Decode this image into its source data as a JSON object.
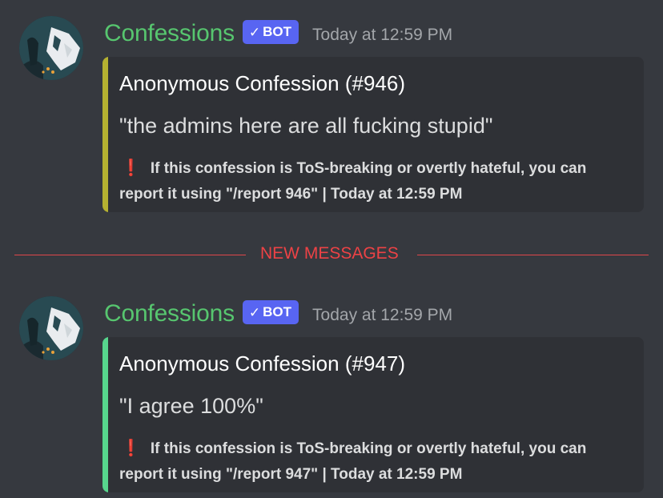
{
  "messages": [
    {
      "author": "Confessions",
      "bot_tag": "BOT",
      "timestamp": "Today at 12:59 PM",
      "embed": {
        "title": "Anonymous Confession (#946)",
        "description": "\"the admins here are all fucking stupid\"",
        "footer_icon": "❗",
        "footer_text": "If this confession is ToS-breaking or overtly hateful, you can report it using \"/report 946\" | Today at 12:59 PM",
        "color": "#b5b131"
      }
    },
    {
      "author": "Confessions",
      "bot_tag": "BOT",
      "timestamp": "Today at 12:59 PM",
      "embed": {
        "title": "Anonymous Confession (#947)",
        "description": "\"I agree 100%\"",
        "footer_icon": "❗",
        "footer_text": "If this confession is ToS-breaking or overtly hateful, you can report it using \"/report 947\" | Today at 12:59 PM",
        "color": "#57d68d"
      }
    }
  ],
  "divider": {
    "label": "NEW MESSAGES"
  },
  "icons": {
    "bot_check": "check-icon",
    "footer": "exclamation-icon"
  },
  "colors": {
    "background": "#36393f",
    "embed_background": "#2f3136",
    "username": "#57c66f",
    "bot_tag": "#5865f2",
    "new_messages": "#ed4245"
  }
}
